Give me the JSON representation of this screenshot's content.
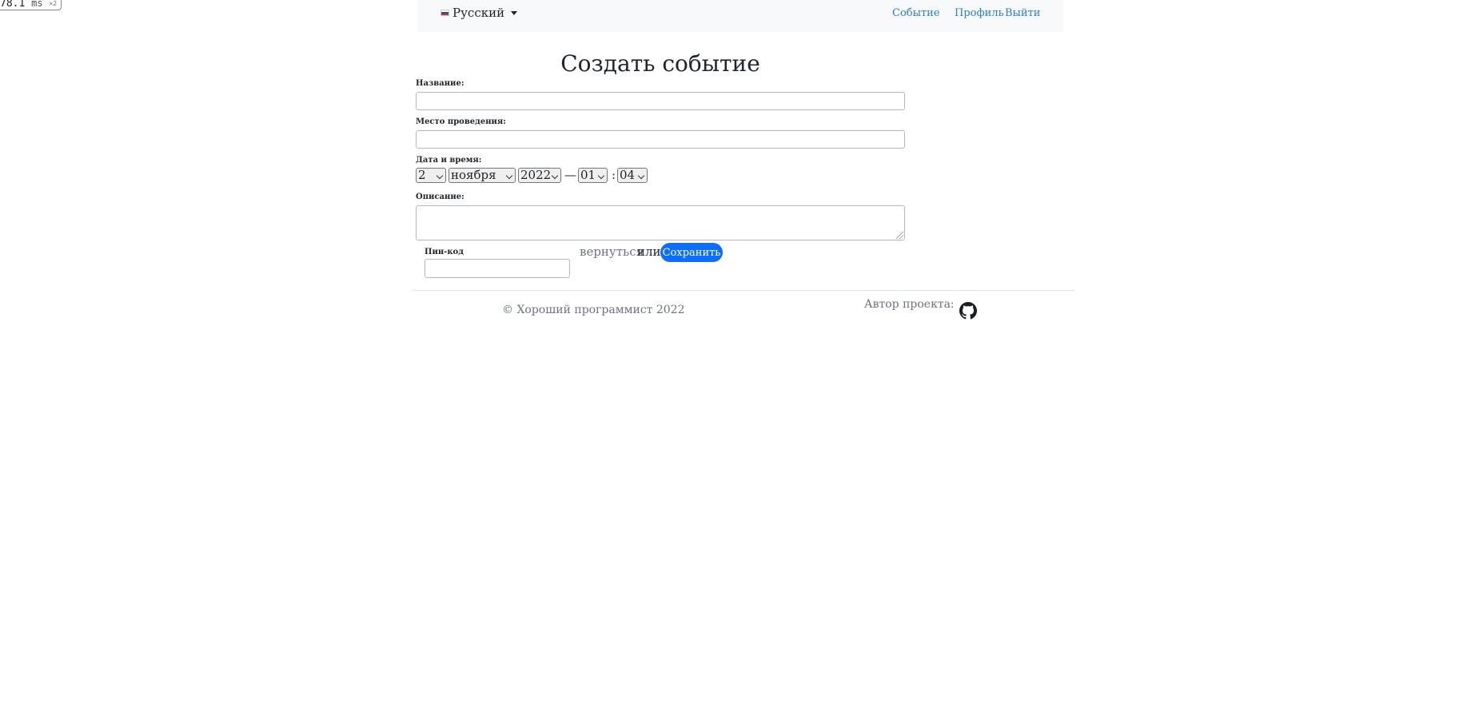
{
  "perf": {
    "value": "78.1",
    "unit": "ms",
    "multiplier": "×2"
  },
  "navbar": {
    "language": {
      "label": "Русский",
      "flag_icon": "russia-flag-icon"
    },
    "links": {
      "event": "Событие",
      "profile": "Профиль",
      "logout": "Выйти"
    },
    "link_color": "#2a7bd3",
    "background": "#f8f9fa"
  },
  "form": {
    "title": "Создать событие",
    "name_label": "Название:",
    "name_value": "",
    "venue_label": "Место проведения:",
    "venue_value": "",
    "datetime_label": "Дата и время:",
    "day": "2",
    "month": "ноября",
    "year": "2022",
    "dash": "—",
    "hour": "01",
    "colon": ":",
    "minute": "04",
    "description_label": "Описание:",
    "description_value": "",
    "pin_label": "Пин-код",
    "pin_value": "",
    "back_link": "вернуться",
    "or_text": "или",
    "save_button": "Сохранить",
    "accent_color": "#0d6efd"
  },
  "footer": {
    "copyright": "© Хороший программист 2022",
    "author_label": "Автор проекта:",
    "author_icon": "github-icon"
  }
}
